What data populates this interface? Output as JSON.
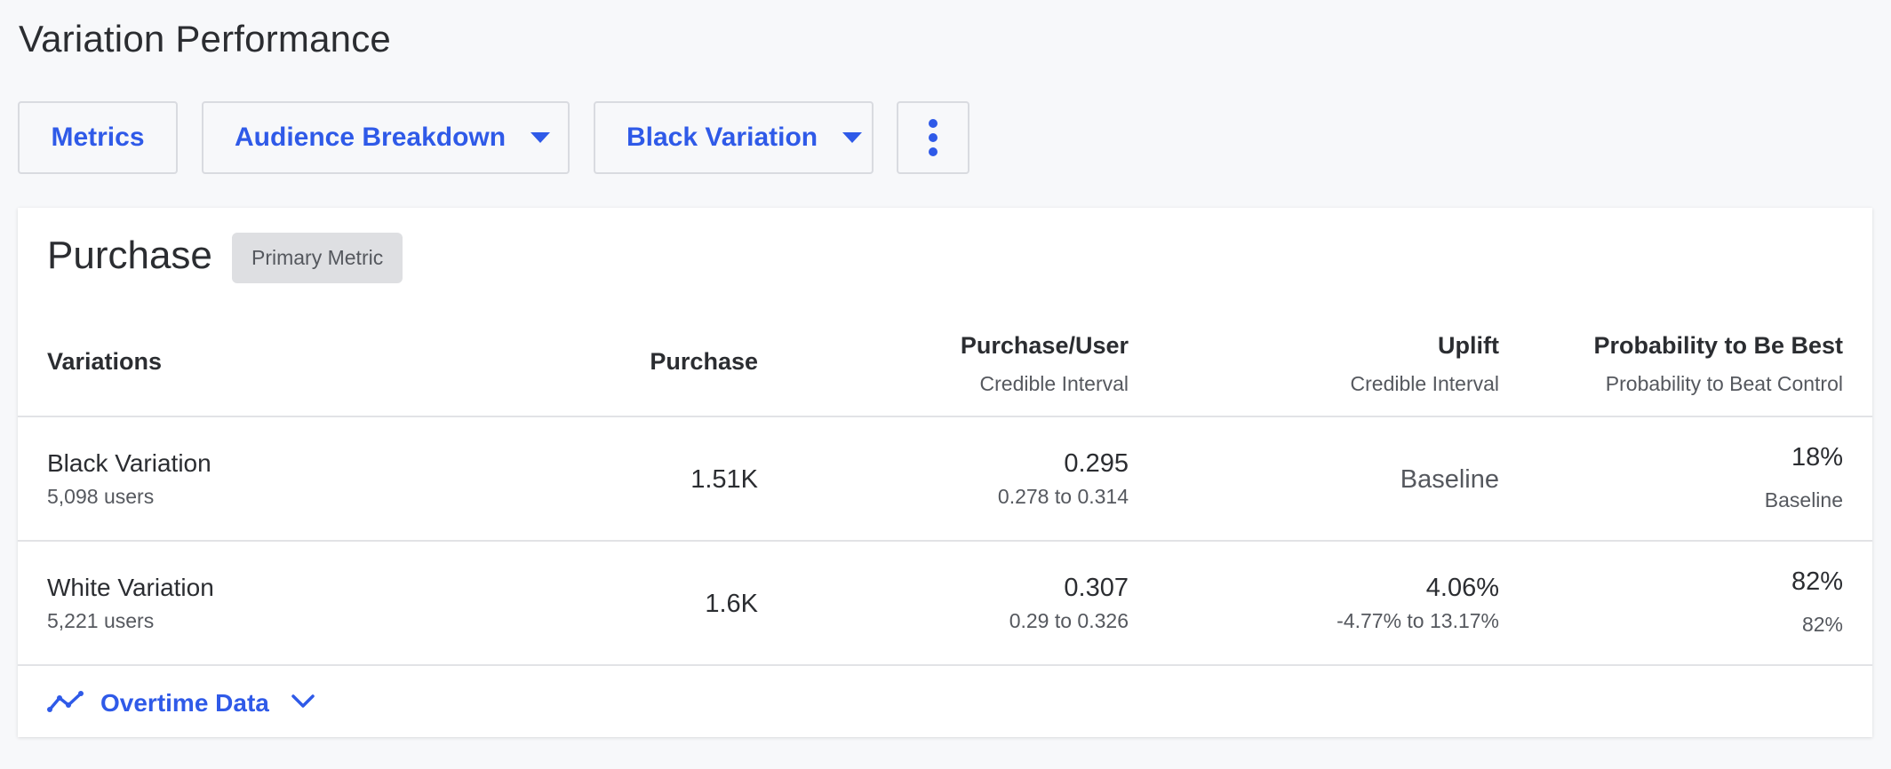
{
  "page": {
    "title": "Variation Performance"
  },
  "toolbar": {
    "metrics_label": "Metrics",
    "audience_label": "Audience Breakdown",
    "variation_label": "Black Variation",
    "more_icon": "kebab-vertical-icon"
  },
  "card": {
    "title": "Purchase",
    "badge": "Primary Metric",
    "columns": {
      "variations": "Variations",
      "purchase": "Purchase",
      "purchase_per_user": "Purchase/User",
      "purchase_per_user_sub": "Credible Interval",
      "uplift": "Uplift",
      "uplift_sub": "Credible Interval",
      "prob_best": "Probability to Be Best",
      "prob_best_sub": "Probability to Beat Control"
    },
    "rows": [
      {
        "name": "Black Variation",
        "users": "5,098 users",
        "purchase": "1.51K",
        "ppu": "0.295",
        "ppu_interval": "0.278 to 0.314",
        "uplift": "Baseline",
        "prob_best": "18%",
        "prob_beat": "Baseline"
      },
      {
        "name": "White Variation",
        "users": "5,221 users",
        "purchase": "1.6K",
        "ppu": "0.307",
        "ppu_interval": "0.29 to 0.326",
        "uplift": "4.06%",
        "uplift_interval": "-4.77% to 13.17%",
        "prob_best": "82%",
        "prob_beat": "82%"
      }
    ],
    "footer": {
      "label": "Overtime Data",
      "icon": "trend-line-icon",
      "expand_icon": "chevron-down-icon"
    }
  },
  "colors": {
    "accent": "#2f5ae8",
    "background": "#f7f8fa",
    "text": "#2b2d31",
    "muted": "#55585e"
  }
}
